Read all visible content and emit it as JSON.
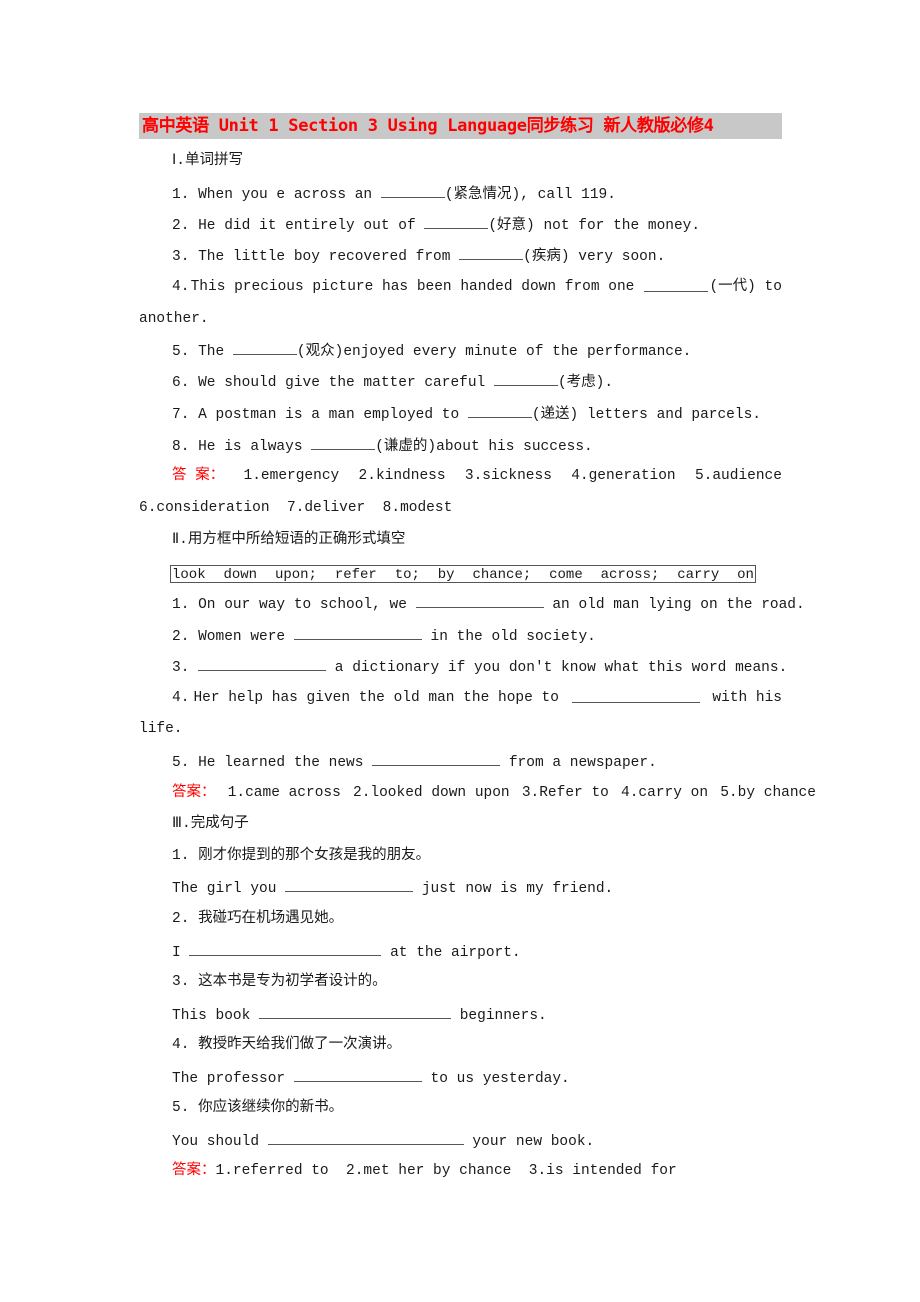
{
  "title": "高中英语 Unit 1 Section 3 Using Language同步练习 新人教版必修4",
  "section1": {
    "heading": "Ⅰ.单词拼写",
    "items": [
      {
        "num": "1.",
        "before": "When you e across an ",
        "hint": "(紧急情况), call 119."
      },
      {
        "num": "2.",
        "before": "He did it entirely out of ",
        "hint": "(好意) not for the money."
      },
      {
        "num": "3.",
        "before": "The little boy recovered from ",
        "hint": "(疾病) very soon."
      },
      {
        "num": "4.",
        "before": "This precious picture has been handed down from one ",
        "hint": "(一代) to",
        "continuation": "another."
      },
      {
        "num": "5.",
        "before": "The ",
        "hint": "(观众)enjoyed every minute of the performance."
      },
      {
        "num": "6.",
        "before": "We should give the matter careful ",
        "hint": "(考虑)."
      },
      {
        "num": "7.",
        "before": "A postman is a man employed to ",
        "hint": "(递送) letters and parcels."
      },
      {
        "num": "8.",
        "before": "He is always ",
        "hint": "(谦虚的)about his success."
      }
    ],
    "answer_label": "答 案：",
    "answers_line1": [
      "1.emergency",
      "2.kindness",
      "3.sickness",
      "4.generation",
      "5.audience"
    ],
    "answers_line2": [
      "6.consideration",
      "7.deliver",
      "8.modest"
    ]
  },
  "section2": {
    "heading": "Ⅱ.用方框中所给短语的正确形式填空",
    "phrases": [
      "look",
      "down",
      "upon;",
      "refer",
      "to;",
      "by",
      "chance;",
      "come",
      "across;",
      "carry",
      "on"
    ],
    "items": [
      {
        "num": "1.",
        "before": "On our way to school, we ",
        "after": " an old man lying on the road."
      },
      {
        "num": "2.",
        "before": "Women were ",
        "after": " in the old society."
      },
      {
        "num": "3.",
        "before": "",
        "after": " a dictionary if you don't know what this word means."
      },
      {
        "num": "4.",
        "before": "Her help has given the old man the hope to ",
        "after": " with his",
        "continuation": "life."
      },
      {
        "num": "5.",
        "before": "He learned the news ",
        "after": " from a newspaper."
      }
    ],
    "answer_label": "答案：",
    "answers": [
      "1.came across",
      "2.looked down upon",
      "3.Refer to",
      "4.carry on",
      "5.by chance"
    ]
  },
  "section3": {
    "heading": "Ⅲ.完成句子",
    "items": [
      {
        "num": "1.",
        "chinese": "刚才你提到的那个女孩是我的朋友。",
        "before": "The girl you ",
        "after": " just now is my friend."
      },
      {
        "num": "2.",
        "chinese": "我碰巧在机场遇见她。",
        "before": "I ",
        "after": " at the airport."
      },
      {
        "num": "3.",
        "chinese": "这本书是专为初学者设计的。",
        "before": "This book ",
        "after": " beginners."
      },
      {
        "num": "4.",
        "chinese": "教授昨天给我们做了一次演讲。",
        "before": "The professor ",
        "after": " to us yesterday."
      },
      {
        "num": "5.",
        "chinese": "你应该继续你的新书。",
        "before": "You should ",
        "after": " your new book."
      }
    ],
    "answer_label": "答案：",
    "answers": [
      "1.referred to",
      "2.met her by chance",
      "3.is intended for"
    ]
  }
}
